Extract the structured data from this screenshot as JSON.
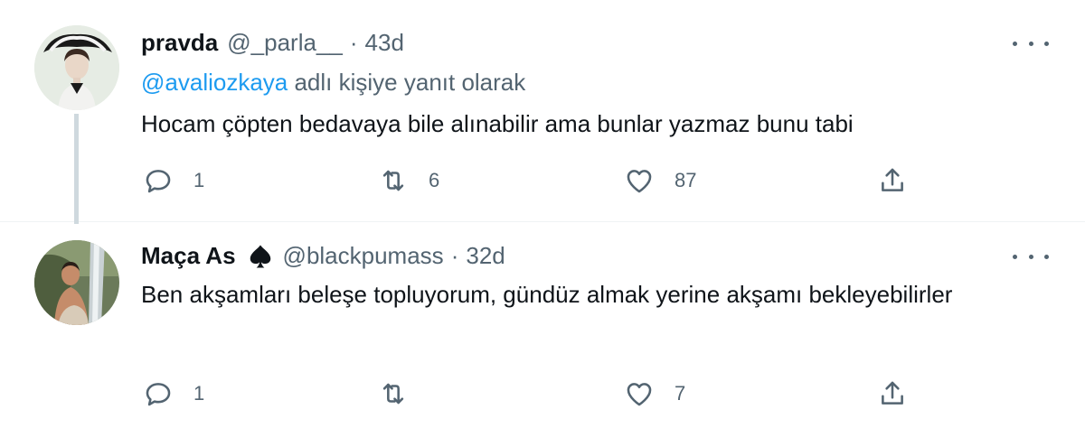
{
  "tweets": [
    {
      "name": "pravda",
      "handle": "@_parla__",
      "separator": "·",
      "time": "43d",
      "reply_to_mention": "@avaliozkaya",
      "reply_to_suffix": " adlı kişiye yanıt olarak",
      "text": "Hocam çöpten bedavaya bile alınabilir ama bunlar yazmaz bunu tabi",
      "replies": "1",
      "retweets": "6",
      "likes": "87"
    },
    {
      "name": "Maça As",
      "name_emoji": "spade-icon",
      "handle": "@blackpumass",
      "separator": "·",
      "time": "32d",
      "text": "Ben akşamları beleşe topluyorum, gündüz almak yerine akşamı bekleyebilirler",
      "replies": "1",
      "retweets": "",
      "likes": "7"
    }
  ],
  "colors": {
    "text": "#0f1419",
    "secondary": "#536471",
    "link": "#1d9bf0",
    "thread_line": "#cfd9de"
  }
}
